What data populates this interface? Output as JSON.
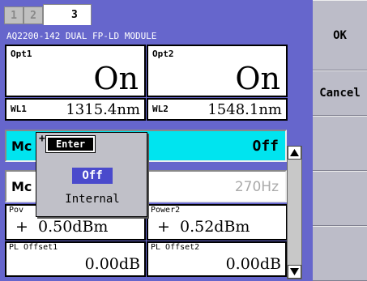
{
  "tabs": [
    "1",
    "2",
    "3"
  ],
  "module_title": "AQ2200-142 DUAL FP-LD MODULE",
  "opt1": {
    "label": "Opt1",
    "value": "On"
  },
  "opt2": {
    "label": "Opt2",
    "value": "On"
  },
  "wl1": {
    "label": "WL1",
    "value": "1315.4nm"
  },
  "wl2": {
    "label": "WL2",
    "value": "1548.1nm"
  },
  "mod_row": {
    "label": "Mc",
    "value": "Off"
  },
  "mod_freq_row": {
    "label": "Mc",
    "value": "270Hz"
  },
  "power1": {
    "label": "Pov",
    "value": "+  0.50dBm"
  },
  "power2": {
    "label": "Power2",
    "value": "+  0.52dBm"
  },
  "pl_offset1": {
    "label": "PL Offset1",
    "value": "0.00dB"
  },
  "pl_offset2": {
    "label": "PL Offset2",
    "value": "0.00dB"
  },
  "popup": {
    "plus": "+",
    "enter": "Enter",
    "off": "Off",
    "internal": "Internal"
  },
  "softkeys": {
    "ok": "OK",
    "cancel": "Cancel"
  },
  "colors": {
    "panel": "#6666cc",
    "selected_row": "#00e4ef",
    "highlight_off": "#4a4acc"
  }
}
